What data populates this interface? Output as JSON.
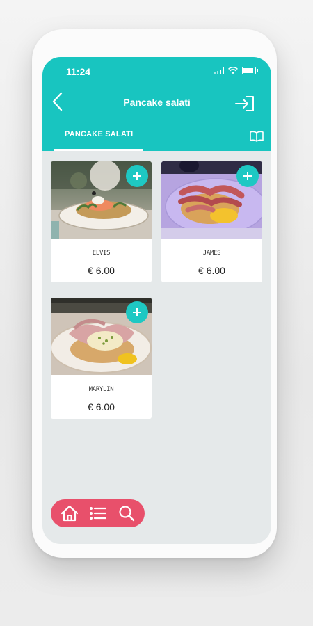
{
  "status": {
    "time": "11:24"
  },
  "header": {
    "title": "Pancake salati"
  },
  "tabs": [
    {
      "label": "PANCAKE SALATI",
      "active": true
    }
  ],
  "products": [
    {
      "name": "ELVIS",
      "price": "€ 6.00",
      "image": "pancake-salmon-photo"
    },
    {
      "name": "JAMES",
      "price": "€ 6.00",
      "image": "pancake-bacon-egg-photo"
    },
    {
      "name": "MARYLIN",
      "price": "€ 6.00",
      "image": "pancake-ham-cheese-photo"
    }
  ],
  "bottom_nav": [
    {
      "icon": "home-icon"
    },
    {
      "icon": "list-icon"
    },
    {
      "icon": "search-icon"
    }
  ],
  "colors": {
    "header": "#18c5c0",
    "content_bg": "#e5e9ea",
    "nav_bg": "#e8506b",
    "add_button": "#1ec8c3"
  }
}
